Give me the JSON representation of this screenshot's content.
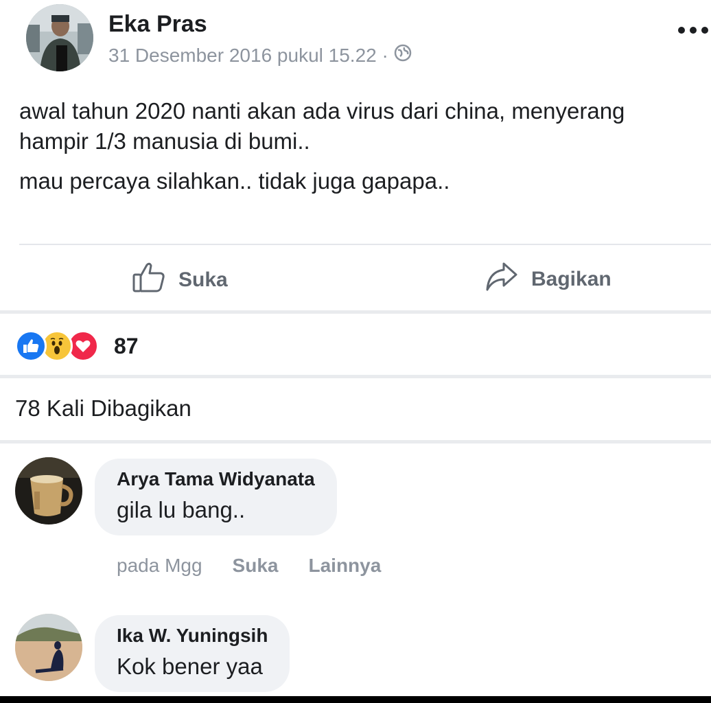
{
  "post": {
    "author": "Eka Pras",
    "timestamp": "31 Desember 2016 pukul 15.22 ·",
    "privacy_icon": "globe-icon",
    "more_icon": "more-dots-icon",
    "text_line1": "awal tahun 2020 nanti akan ada virus dari china, menyerang",
    "text_line2": "hampir 1/3 manusia di bumi..",
    "text_line3": "mau percaya silahkan.. tidak juga gapapa.."
  },
  "actions": {
    "like_label": "Suka",
    "like_icon": "thumbs-up-icon",
    "share_label": "Bagikan",
    "share_icon": "share-arrow-icon"
  },
  "reactions": {
    "icons": [
      "like-reaction-icon",
      "wow-reaction-icon",
      "love-reaction-icon"
    ],
    "count": "87"
  },
  "shares": {
    "label": "78 Kali Dibagikan"
  },
  "comments": [
    {
      "name": "Arya Tama Widyanata",
      "text": "gila lu bang..",
      "time": "pada Mgg",
      "like_label": "Suka",
      "more_label": "Lainnya"
    },
    {
      "name": "Ika W. Yuningsih",
      "text": "Kok bener yaa"
    }
  ],
  "colors": {
    "like_blue": "#1877f2",
    "wow_yellow": "#f7c53a",
    "love_red": "#f0284a",
    "bubble_bg": "#f0f2f5",
    "muted_text": "#8d949e"
  }
}
